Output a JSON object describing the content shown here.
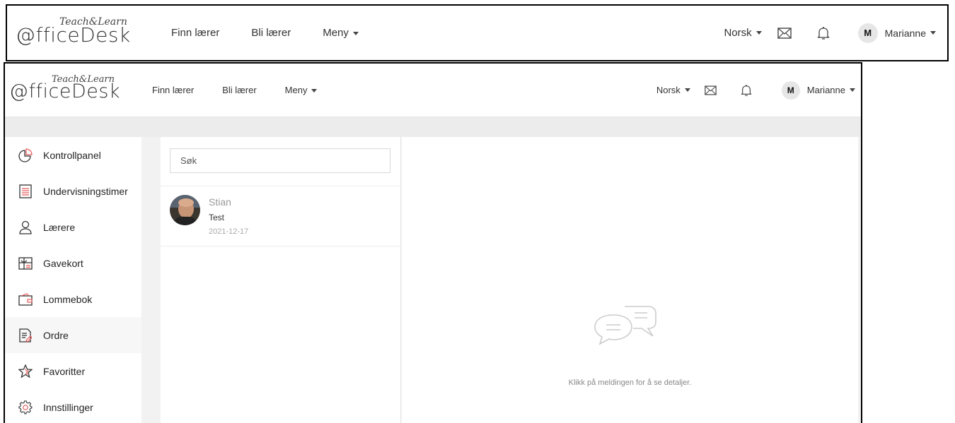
{
  "brand": {
    "main": "@fficeDesk",
    "tag": "Teach&Learn"
  },
  "nav": {
    "find_teacher": "Finn lærer",
    "become_teacher": "Bli lærer",
    "menu": "Meny"
  },
  "header_right": {
    "language": "Norsk",
    "user_initial": "M",
    "user_name": "Marianne"
  },
  "sidebar": {
    "items": [
      {
        "label": "Kontrollpanel",
        "icon": "pie-chart-icon"
      },
      {
        "label": "Undervisningstimer",
        "icon": "lessons-icon"
      },
      {
        "label": "Lærere",
        "icon": "teacher-person-icon"
      },
      {
        "label": "Gavekort",
        "icon": "gift-card-icon"
      },
      {
        "label": "Lommebok",
        "icon": "wallet-icon"
      },
      {
        "label": "Ordre",
        "icon": "order-icon"
      },
      {
        "label": "Favoritter",
        "icon": "star-icon"
      },
      {
        "label": "Innstillinger",
        "icon": "gear-icon"
      }
    ],
    "active_index": 5
  },
  "messages": {
    "search_placeholder": "Søk",
    "items": [
      {
        "name": "Stian",
        "text": "Test",
        "date": "2021-12-17"
      }
    ]
  },
  "detail": {
    "empty_text": "Klikk på meldingen for å se detaljer."
  },
  "colors": {
    "accent": "#e85b5b",
    "border": "#000000",
    "background": "#f2f2f2"
  }
}
